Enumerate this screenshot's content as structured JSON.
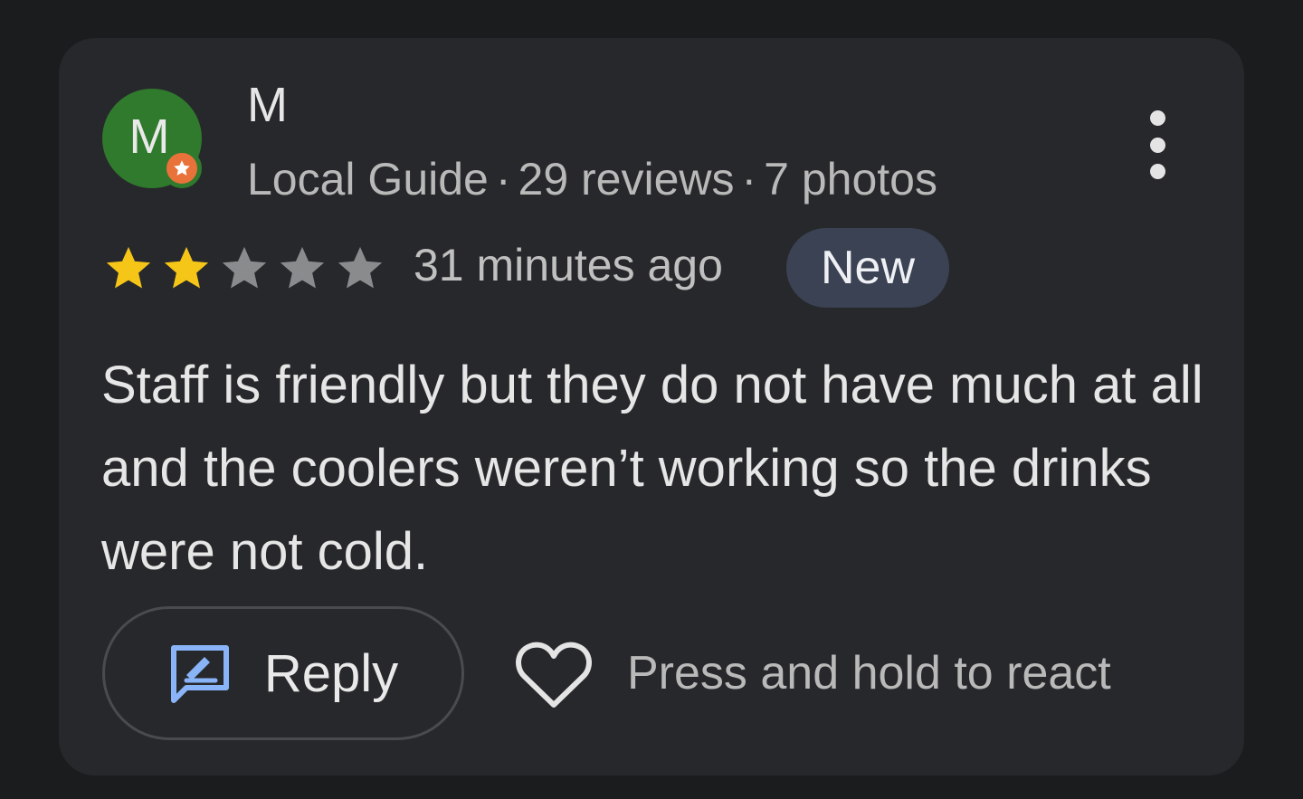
{
  "reviewer": {
    "avatar_letter": "M",
    "avatar_color": "#2f7a2d",
    "badge_icon": "local-guide-star-badge",
    "name": "M",
    "level": "Local Guide",
    "reviews": "29 reviews",
    "photos": "7 photos",
    "separator": "·"
  },
  "rating": {
    "stars_filled": 2,
    "stars_total": 5,
    "filled_color": "#f5c518",
    "empty_color": "#8a8b8d"
  },
  "timestamp": "31 minutes ago",
  "badge": "New",
  "review_text": "Staff is friendly but they do not have much at all and the coolers weren’t working so the drinks were not cold.",
  "actions": {
    "more_icon": "more-vert-icon",
    "reply_label": "Reply",
    "reply_icon": "reply-edit-icon",
    "reply_icon_color": "#8ab4f8",
    "react_icon": "heart-outline-icon",
    "react_hint": "Press and hold to react"
  }
}
